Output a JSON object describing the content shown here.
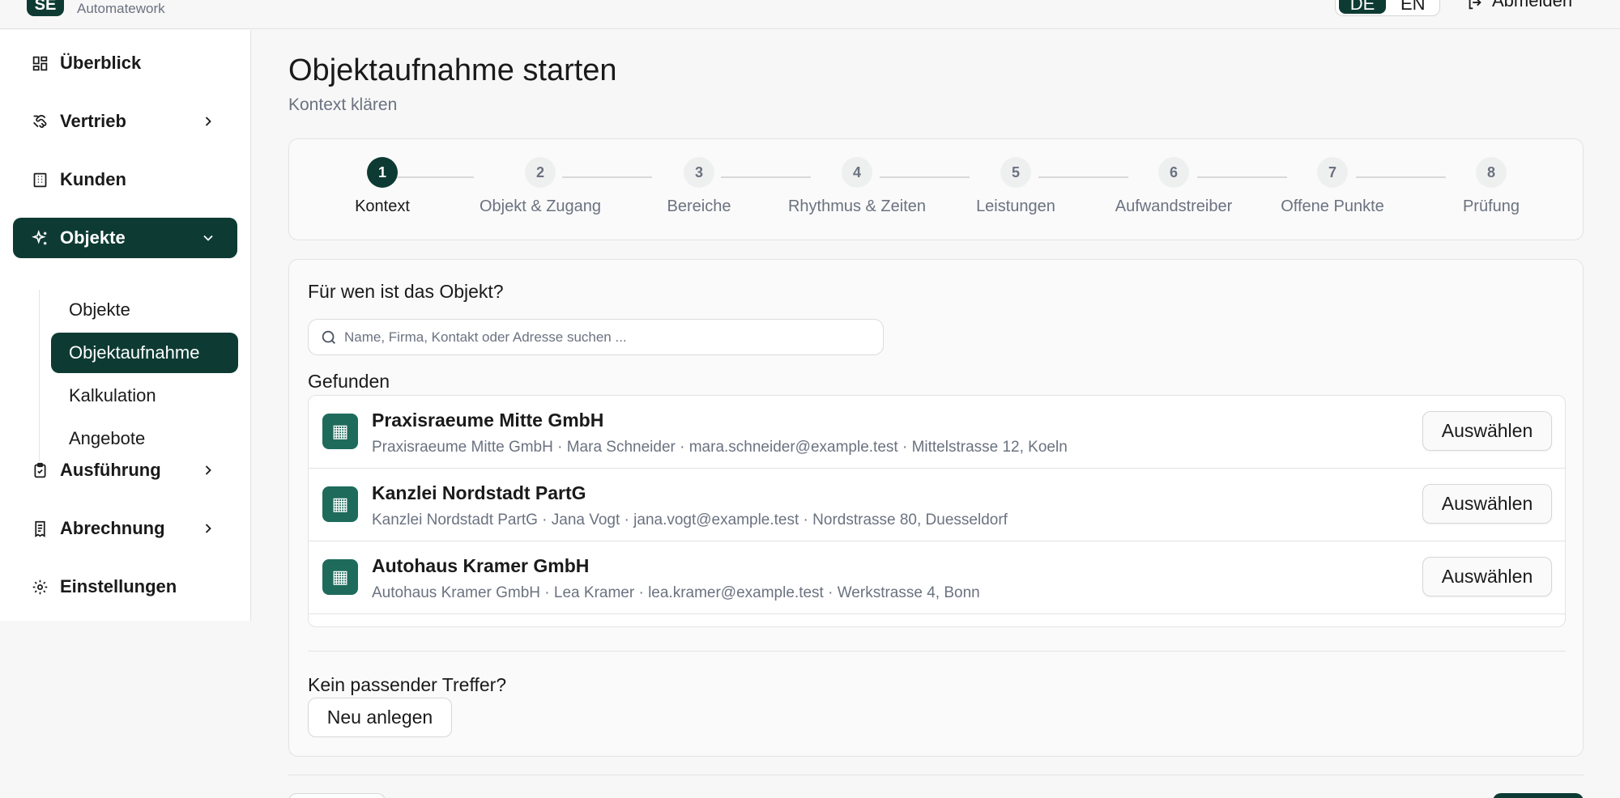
{
  "brand": {
    "logo_text": "SE",
    "subtitle": "Automatework"
  },
  "header": {
    "lang_de": "DE",
    "lang_en": "EN",
    "logout_label": "Abmelden"
  },
  "sidebar": {
    "items": [
      {
        "label": "Überblick"
      },
      {
        "label": "Vertrieb"
      },
      {
        "label": "Kunden"
      },
      {
        "label": "Objekte"
      },
      {
        "label": "Ausführung"
      },
      {
        "label": "Abrechnung"
      },
      {
        "label": "Einstellungen"
      }
    ],
    "sub_items": [
      {
        "label": "Objekte"
      },
      {
        "label": "Objektaufnahme"
      },
      {
        "label": "Kalkulation"
      },
      {
        "label": "Angebote"
      }
    ]
  },
  "page": {
    "title": "Objektaufnahme starten",
    "subtitle": "Kontext klären"
  },
  "steps": [
    {
      "num": "1",
      "label": "Kontext"
    },
    {
      "num": "2",
      "label": "Objekt & Zugang"
    },
    {
      "num": "3",
      "label": "Bereiche"
    },
    {
      "num": "4",
      "label": "Rhythmus & Zeiten"
    },
    {
      "num": "5",
      "label": "Leistungen"
    },
    {
      "num": "6",
      "label": "Aufwandstreiber"
    },
    {
      "num": "7",
      "label": "Offene Punkte"
    },
    {
      "num": "8",
      "label": "Prüfung"
    }
  ],
  "context": {
    "question": "Für wen ist das Objekt?",
    "search_placeholder": "Name, Firma, Kontakt oder Adresse suchen ...",
    "found_label": "Gefunden",
    "results": [
      {
        "name": "Praxisraeume Mitte GmbH",
        "meta": "Praxisraeume Mitte GmbH · Mara Schneider · mara.schneider@example.test · Mittelstrasse 12, Koeln",
        "action": "Auswählen"
      },
      {
        "name": "Kanzlei Nordstadt PartG",
        "meta": "Kanzlei Nordstadt PartG · Jana Vogt · jana.vogt@example.test · Nordstrasse 80, Duesseldorf",
        "action": "Auswählen"
      },
      {
        "name": "Autohaus Kramer GmbH",
        "meta": "Autohaus Kramer GmbH · Lea Kramer · lea.kramer@example.test · Werkstrasse 4, Bonn",
        "action": "Auswählen"
      }
    ],
    "no_match_label": "Kein passender Treffer?",
    "new_button": "Neu anlegen"
  },
  "colors": {
    "primary": "#0d3b33",
    "accent": "#1e6b5c",
    "muted": "#6b7280"
  }
}
